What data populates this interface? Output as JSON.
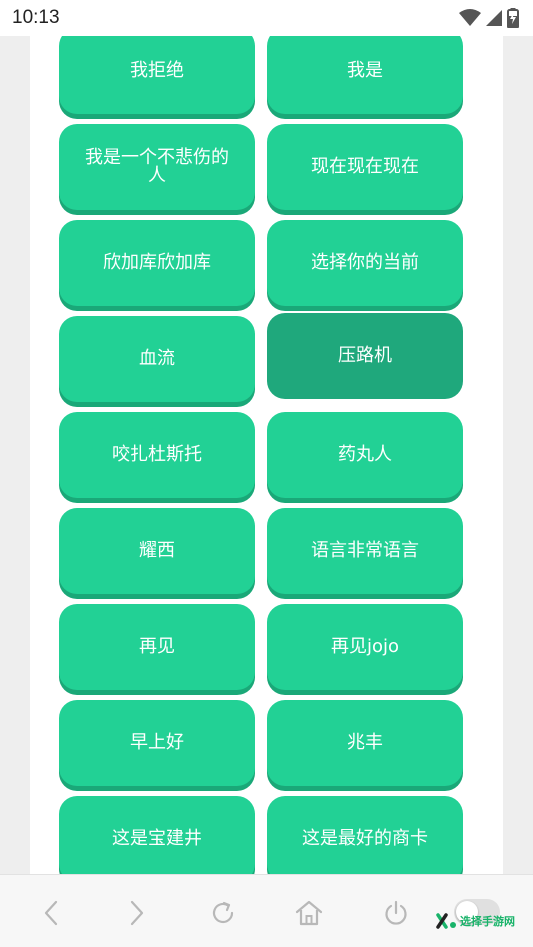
{
  "status_bar": {
    "time": "10:13",
    "icons": [
      "wifi-icon",
      "signal-icon",
      "battery-charging-icon"
    ]
  },
  "buttons": [
    {
      "label": "我拒绝"
    },
    {
      "label": "我是"
    },
    {
      "label": "我是一个不悲伤的人"
    },
    {
      "label": "现在现在现在"
    },
    {
      "label": "欣加库欣加库"
    },
    {
      "label": "选择你的当前"
    },
    {
      "label": "血流"
    },
    {
      "label": "压路机",
      "pressed": true
    },
    {
      "label": "咬扎杜斯托"
    },
    {
      "label": "药丸人"
    },
    {
      "label": "耀西"
    },
    {
      "label": "语言非常语言"
    },
    {
      "label": "再见"
    },
    {
      "label": "再见jojo"
    },
    {
      "label": "早上好"
    },
    {
      "label": "兆丰"
    },
    {
      "label": "这是宝建井"
    },
    {
      "label": "这是最好的商卡"
    }
  ],
  "nav_bar": {
    "items": [
      "back-icon",
      "forward-icon",
      "refresh-icon",
      "home-icon",
      "power-icon"
    ],
    "toggle_on": false,
    "watermark": "选择手游网"
  },
  "colors": {
    "button": "#22d195",
    "button_shadow": "#1aa878",
    "button_pressed": "#1fa87c"
  }
}
